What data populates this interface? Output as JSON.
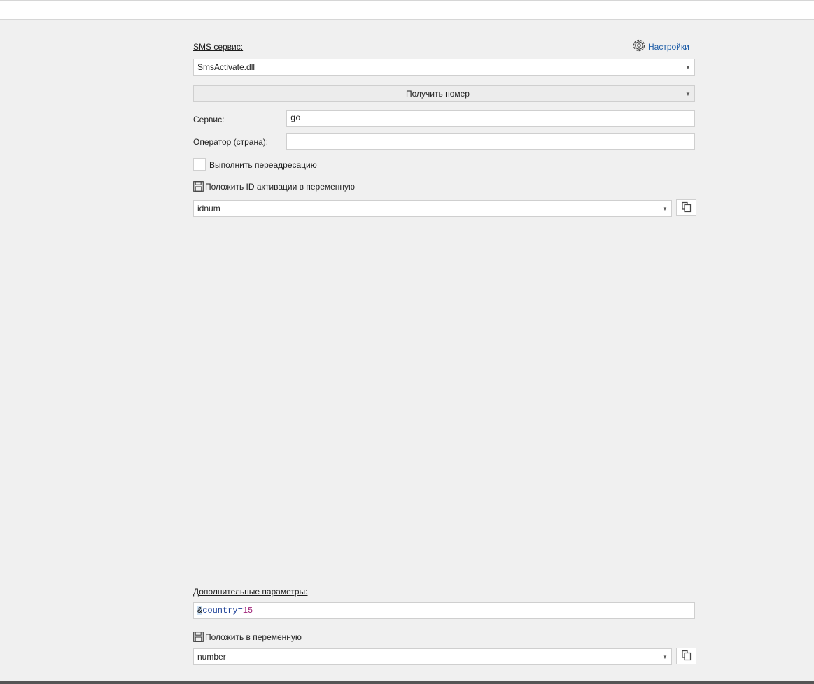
{
  "sms_service": {
    "label": "SMS сервис:",
    "settings_link": "Настройки",
    "dll_value": "SmsActivate.dll",
    "action_value": "Получить номер"
  },
  "form": {
    "service_label": "Сервис:",
    "service_value": "go",
    "operator_label": "Оператор (страна):",
    "operator_value": "",
    "redirect_label": "Выполнить переадресацию",
    "save_id_label": "Положить ID активации в переменную",
    "id_var_value": "idnum"
  },
  "extra": {
    "label": "Дополнительные параметры:",
    "param_amp": "&",
    "param_key": "country=",
    "param_val": "15",
    "save_label": "Положить в переменную",
    "var_value": "number"
  },
  "icons": {
    "settings": "gear-icon",
    "save": "floppy-disk-icon",
    "copy": "copy-icon",
    "dropdown": "chevron-down-icon"
  }
}
